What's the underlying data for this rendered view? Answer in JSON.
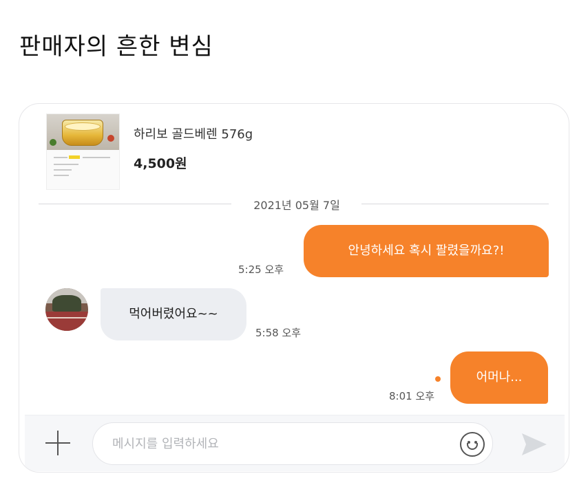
{
  "post": {
    "title": "판매자의 흔한 변심"
  },
  "product": {
    "name": "하리보 골드베렌 576g",
    "price": "4,500원",
    "thumbnail_icon": "haribo-tub-icon"
  },
  "chat": {
    "date": "2021년 05월 7일",
    "messages": [
      {
        "direction": "outgoing",
        "text": "안녕하세요 혹시 팔렸을까요?!",
        "time": "5:25 오후"
      },
      {
        "direction": "incoming",
        "text": "먹어버렸어요~~",
        "time": "5:58 오후"
      },
      {
        "direction": "outgoing",
        "text": "어머나...",
        "time": "8:01 오후",
        "unread": true
      }
    ]
  },
  "composer": {
    "placeholder": "메시지를 입력하세요",
    "value": "",
    "icons": [
      "plus-icon",
      "emoji-icon",
      "send-icon"
    ]
  },
  "colors": {
    "accent": "#f6822a",
    "incoming_bubble": "#eceef2",
    "card_border": "#e6e6e9"
  }
}
